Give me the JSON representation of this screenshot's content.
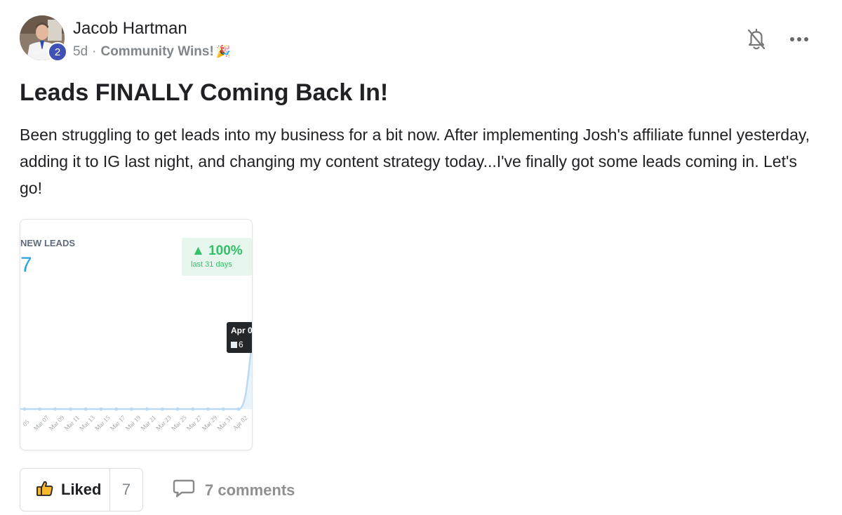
{
  "post": {
    "author": "Jacob Hartman",
    "level": "2",
    "age": "5d",
    "separator": "·",
    "category": "Community Wins!",
    "category_emoji": "🎉",
    "title": "Leads FINALLY Coming Back In!",
    "body": "Been struggling to get leads into my business for a bit now. After implementing Josh's affiliate funnel yesterday, adding it to IG last night, and changing my content strategy today...I've finally got some leads coming in. Let's go!"
  },
  "icons": {
    "notification": "bell-off-icon",
    "more": "more-horizontal-icon",
    "like": "thumbs-up-icon",
    "comment": "comment-bubble-icon"
  },
  "attachment": {
    "label": "NEW LEADS",
    "count": "7",
    "change": "▲ 100%",
    "change_period": "last 31 days",
    "tooltip_date": "Apr 0",
    "tooltip_value": "6",
    "colors": {
      "count": "#27a3e3",
      "positive": "#34c06a",
      "line": "#b9daf3"
    }
  },
  "chart_data": {
    "type": "line",
    "x": [
      "05",
      "Mar 07",
      "Mar 09",
      "Mar 11",
      "Mar 13",
      "Mar 15",
      "Mar 17",
      "Mar 19",
      "Mar 21",
      "Mar 23",
      "Mar 25",
      "Mar 27",
      "Mar 29",
      "Mar 31",
      "Apr 02",
      "Ap"
    ],
    "series": [
      {
        "values": [
          0,
          0,
          0,
          0,
          0,
          0,
          0,
          0,
          0,
          0,
          0,
          0,
          0,
          0,
          0,
          6
        ]
      }
    ],
    "ylim": [
      0,
      7
    ],
    "grid": false
  },
  "footer": {
    "like_label": "Liked",
    "like_count": "7",
    "comments_label": "7 comments"
  }
}
